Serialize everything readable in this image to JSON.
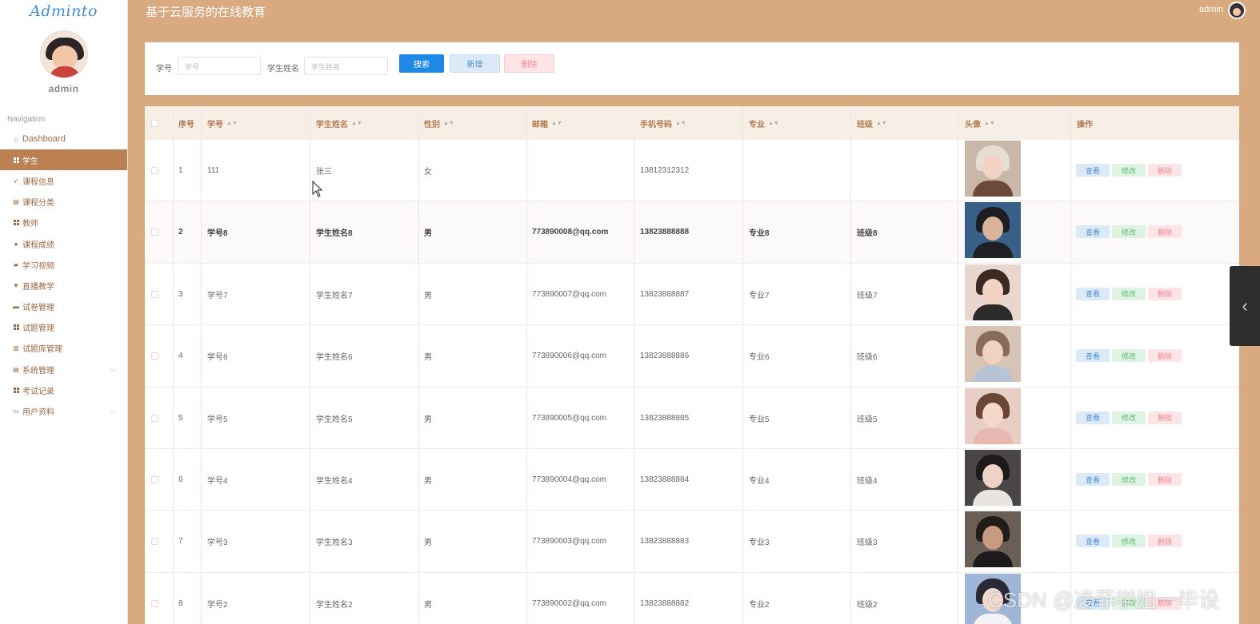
{
  "sidebar": {
    "logo": "Adminto",
    "user": "admin",
    "nav_heading": "Navigation",
    "items": [
      {
        "label": "Dashboard",
        "icon": "home-icon",
        "active": false
      },
      {
        "label": "学生",
        "icon": "grid-icon",
        "active": true
      },
      {
        "label": "课程信息",
        "icon": "send-icon",
        "active": false
      },
      {
        "label": "课程分类",
        "icon": "clipboard-icon",
        "active": false
      },
      {
        "label": "教师",
        "icon": "grid-icon",
        "active": false
      },
      {
        "label": "课程成绩",
        "icon": "pin-icon",
        "active": false
      },
      {
        "label": "学习视频",
        "icon": "thumbs-up-icon",
        "active": false
      },
      {
        "label": "直播教学",
        "icon": "trophy-icon",
        "active": false
      },
      {
        "label": "试卷管理",
        "icon": "monitor-icon",
        "active": false
      },
      {
        "label": "试题管理",
        "icon": "grid-icon",
        "active": false
      },
      {
        "label": "试题库管理",
        "icon": "bar-chart-icon",
        "active": false
      },
      {
        "label": "系统管理",
        "icon": "clipboard-icon",
        "active": false,
        "expandable": true
      },
      {
        "label": "考试记录",
        "icon": "grid-icon",
        "active": false
      },
      {
        "label": "用户资料",
        "icon": "card-icon",
        "active": false,
        "expandable": true
      }
    ]
  },
  "header": {
    "title": "基于云服务的在线教育",
    "user": "admin"
  },
  "search": {
    "student_id_label": "学号",
    "student_id_placeholder": "学号",
    "student_name_label": "学生姓名",
    "student_name_placeholder": "学生姓名",
    "search_button": "搜索",
    "add_button": "新增",
    "delete_button": "删除"
  },
  "table": {
    "columns": [
      "序号",
      "学号",
      "学生姓名",
      "性别",
      "邮箱",
      "手机号码",
      "专业",
      "班级",
      "头像",
      "操作"
    ],
    "row_actions": {
      "view": "查看",
      "edit": "修改",
      "delete": "删除"
    },
    "rows": [
      {
        "no": "1",
        "student_id": "111",
        "name": "张三",
        "gender": "女",
        "email": "",
        "phone": "13812312312",
        "major": "",
        "class": ""
      },
      {
        "no": "2",
        "student_id": "学号8",
        "name": "学生姓名8",
        "gender": "男",
        "email": "773890008@qq.com",
        "phone": "13823888888",
        "major": "专业8",
        "class": "班级8"
      },
      {
        "no": "3",
        "student_id": "学号7",
        "name": "学生姓名7",
        "gender": "男",
        "email": "773890007@qq.com",
        "phone": "13823888887",
        "major": "专业7",
        "class": "班级7"
      },
      {
        "no": "4",
        "student_id": "学号6",
        "name": "学生姓名6",
        "gender": "男",
        "email": "773890006@qq.com",
        "phone": "13823888886",
        "major": "专业6",
        "class": "班级6"
      },
      {
        "no": "5",
        "student_id": "学号5",
        "name": "学生姓名5",
        "gender": "男",
        "email": "773890005@qq.com",
        "phone": "13823888885",
        "major": "专业5",
        "class": "班级5"
      },
      {
        "no": "6",
        "student_id": "学号4",
        "name": "学生姓名4",
        "gender": "男",
        "email": "773890004@qq.com",
        "phone": "13823888884",
        "major": "专业4",
        "class": "班级4"
      },
      {
        "no": "7",
        "student_id": "学号3",
        "name": "学生姓名3",
        "gender": "男",
        "email": "773890003@qq.com",
        "phone": "13823888883",
        "major": "专业3",
        "class": "班级3"
      },
      {
        "no": "8",
        "student_id": "学号2",
        "name": "学生姓名2",
        "gender": "男",
        "email": "773890002@qq.com",
        "phone": "13823888882",
        "major": "专业2",
        "class": "班级2"
      }
    ]
  },
  "watermark": "CSDN @凌菲学姐一毕设",
  "colors": {
    "background": "#d9a97f",
    "active_nav": "#bb8052",
    "primary": "#1e88e5",
    "table_header_bg": "#f7eee6"
  }
}
